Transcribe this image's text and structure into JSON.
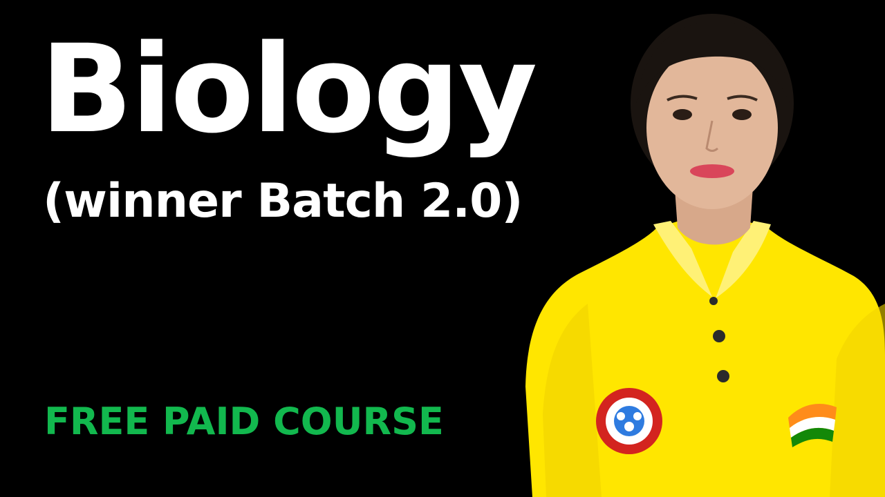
{
  "thumbnail": {
    "title": "Biology",
    "subtitle": "(winner Batch 2.0)",
    "tagline": "FREE PAID COURSE"
  },
  "colors": {
    "background": "#000000",
    "title": "#ffffff",
    "subtitle": "#ffffff",
    "tagline": "#12b84e",
    "shirt": "#ffe600"
  },
  "presenter": {
    "icon": "presenter-photo"
  }
}
